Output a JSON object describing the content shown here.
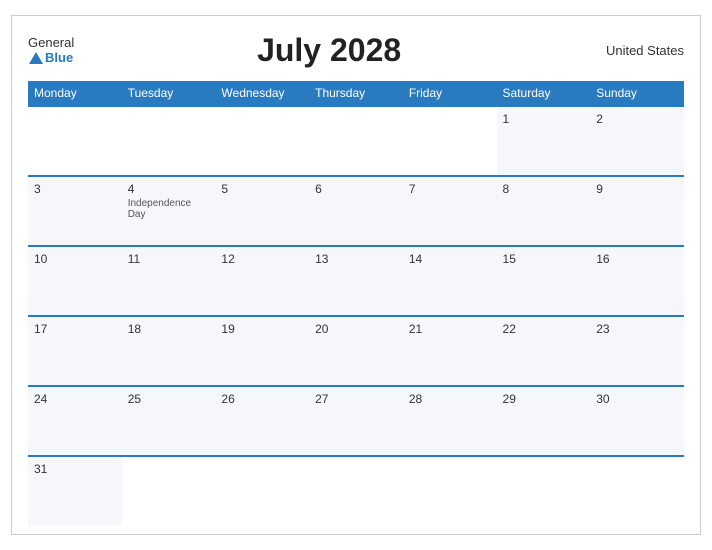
{
  "header": {
    "logo_general": "General",
    "logo_blue": "Blue",
    "month_title": "July 2028",
    "country": "United States"
  },
  "weekdays": [
    "Monday",
    "Tuesday",
    "Wednesday",
    "Thursday",
    "Friday",
    "Saturday",
    "Sunday"
  ],
  "weeks": [
    [
      {
        "day": "",
        "empty": true
      },
      {
        "day": "",
        "empty": true
      },
      {
        "day": "",
        "empty": true
      },
      {
        "day": "",
        "empty": true
      },
      {
        "day": "",
        "empty": true
      },
      {
        "day": "1",
        "event": ""
      },
      {
        "day": "2",
        "event": ""
      }
    ],
    [
      {
        "day": "3",
        "event": ""
      },
      {
        "day": "4",
        "event": "Independence Day"
      },
      {
        "day": "5",
        "event": ""
      },
      {
        "day": "6",
        "event": ""
      },
      {
        "day": "7",
        "event": ""
      },
      {
        "day": "8",
        "event": ""
      },
      {
        "day": "9",
        "event": ""
      }
    ],
    [
      {
        "day": "10",
        "event": ""
      },
      {
        "day": "11",
        "event": ""
      },
      {
        "day": "12",
        "event": ""
      },
      {
        "day": "13",
        "event": ""
      },
      {
        "day": "14",
        "event": ""
      },
      {
        "day": "15",
        "event": ""
      },
      {
        "day": "16",
        "event": ""
      }
    ],
    [
      {
        "day": "17",
        "event": ""
      },
      {
        "day": "18",
        "event": ""
      },
      {
        "day": "19",
        "event": ""
      },
      {
        "day": "20",
        "event": ""
      },
      {
        "day": "21",
        "event": ""
      },
      {
        "day": "22",
        "event": ""
      },
      {
        "day": "23",
        "event": ""
      }
    ],
    [
      {
        "day": "24",
        "event": ""
      },
      {
        "day": "25",
        "event": ""
      },
      {
        "day": "26",
        "event": ""
      },
      {
        "day": "27",
        "event": ""
      },
      {
        "day": "28",
        "event": ""
      },
      {
        "day": "29",
        "event": ""
      },
      {
        "day": "30",
        "event": ""
      }
    ],
    [
      {
        "day": "31",
        "event": ""
      },
      {
        "day": "",
        "empty": true
      },
      {
        "day": "",
        "empty": true
      },
      {
        "day": "",
        "empty": true
      },
      {
        "day": "",
        "empty": true
      },
      {
        "day": "",
        "empty": true
      },
      {
        "day": "",
        "empty": true
      }
    ]
  ]
}
